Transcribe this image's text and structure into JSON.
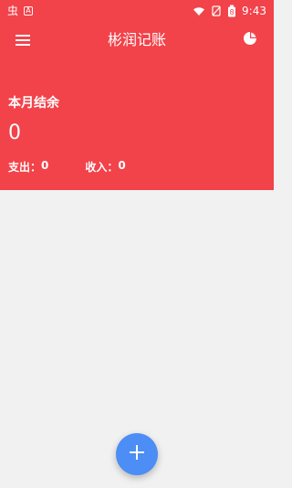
{
  "status_bar": {
    "left_icons": [
      {
        "name": "debug-app-icon",
        "glyph": "虫"
      },
      {
        "name": "a-app-icon",
        "glyph": "A"
      }
    ],
    "time": "9:43",
    "battery_level": "8"
  },
  "app_bar": {
    "title": "彬润记账",
    "menu_icon": "hamburger-menu-icon",
    "stats_icon": "pie-chart-icon"
  },
  "summary": {
    "title": "本月结余",
    "balance": "0",
    "expense": {
      "label": "支出：",
      "value": "0"
    },
    "income": {
      "label": "收入：",
      "value": "0"
    }
  },
  "fab": {
    "icon": "plus-icon"
  },
  "colors": {
    "primary_red": "#f2424a",
    "fab_blue": "#4c8df6",
    "background": "#f1f1f1",
    "text_on_primary": "#ffffff"
  }
}
